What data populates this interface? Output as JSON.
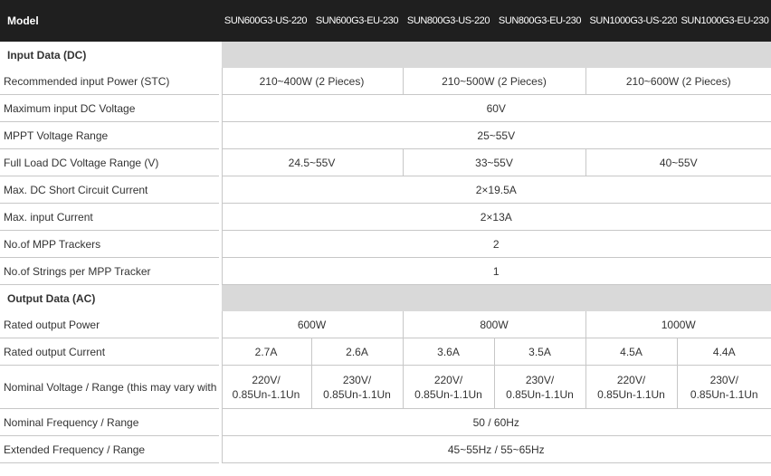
{
  "header": {
    "label": "Model",
    "models": [
      "SUN600G3-US-220",
      "SUN600G3-EU-230",
      "SUN800G3-US-220",
      "SUN800G3-EU-230",
      "SUN1000G3-US-220",
      "SUN1000G3-EU-230"
    ]
  },
  "input": {
    "title": "Input Data (DC)",
    "rec_power": {
      "label": "Recommended input Power (STC)",
      "v600": "210~400W (2 Pieces)",
      "v800": "210~500W (2 Pieces)",
      "v1000": "210~600W (2 Pieces)"
    },
    "max_dc_voltage": {
      "label": "Maximum input DC Voltage",
      "value": "60V"
    },
    "mppt_range": {
      "label": "MPPT Voltage Range",
      "value": "25~55V"
    },
    "full_load": {
      "label": "Full Load DC Voltage Range (V)",
      "v600": "24.5~55V",
      "v800": "33~55V",
      "v1000": "40~55V"
    },
    "short_circuit": {
      "label": "Max. DC Short Circuit Current",
      "value": "2×19.5A"
    },
    "max_current": {
      "label": "Max. input Current",
      "value": "2×13A"
    },
    "trackers": {
      "label": "No.of MPP Trackers",
      "value": "2"
    },
    "strings": {
      "label": "No.of Strings per MPP Tracker",
      "value": "1"
    }
  },
  "output": {
    "title": "Output Data (AC)",
    "rated_power": {
      "label": "Rated output Power",
      "v600": "600W",
      "v800": "800W",
      "v1000": "1000W"
    },
    "rated_current": {
      "label": "Rated output Current",
      "values": [
        "2.7A",
        "2.6A",
        "3.6A",
        "3.5A",
        "4.5A",
        "4.4A"
      ]
    },
    "nominal_voltage": {
      "label": "Nominal Voltage / Range (this may vary with grid standards)",
      "values": [
        {
          "l1": "220V/",
          "l2": "0.85Un-1.1Un"
        },
        {
          "l1": "230V/",
          "l2": "0.85Un-1.1Un"
        },
        {
          "l1": "220V/",
          "l2": "0.85Un-1.1Un"
        },
        {
          "l1": "230V/",
          "l2": "0.85Un-1.1Un"
        },
        {
          "l1": "220V/",
          "l2": "0.85Un-1.1Un"
        },
        {
          "l1": "230V/",
          "l2": "0.85Un-1.1Un"
        }
      ]
    },
    "nominal_freq": {
      "label": "Nominal Frequency / Range",
      "value": "50 / 60Hz"
    },
    "extended_freq": {
      "label": "Extended Frequency / Range",
      "value": "45~55Hz / 55~65Hz"
    }
  }
}
